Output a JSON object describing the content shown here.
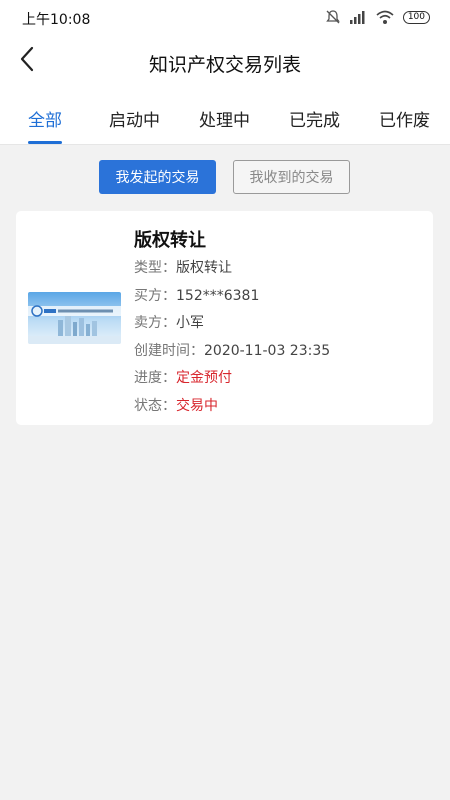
{
  "status_bar": {
    "time": "上午10:08",
    "battery": "100"
  },
  "header": {
    "title": "知识产权交易列表"
  },
  "tabs": [
    {
      "label": "全部",
      "active": true
    },
    {
      "label": "启动中",
      "active": false
    },
    {
      "label": "处理中",
      "active": false
    },
    {
      "label": "已完成",
      "active": false
    },
    {
      "label": "已作废",
      "active": false
    }
  ],
  "segments": {
    "initiated": "我发起的交易",
    "received": "我收到的交易"
  },
  "trade_item": {
    "title": "版权转让",
    "type_label": "类型：",
    "type_value": "版权转让",
    "buyer_label": "买方：",
    "buyer_value": "152***6381",
    "seller_label": "卖方：",
    "seller_value": "小军",
    "created_label": "创建时间：",
    "created_value": "2020-11-03 23:35",
    "progress_label": "进度：",
    "progress_value": "定金预付",
    "state_label": "状态：",
    "state_value": "交易中"
  },
  "colors": {
    "accent": "#1f6fd6",
    "button": "#2b73d9",
    "alert": "#d8262d",
    "background": "#f2f2f2"
  }
}
